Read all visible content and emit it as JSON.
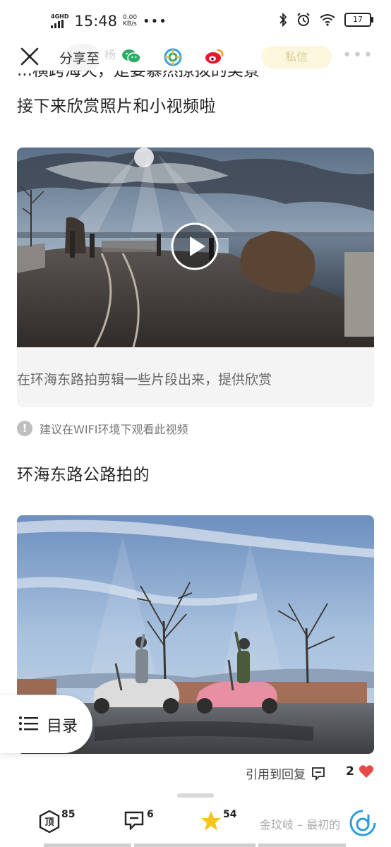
{
  "status_bar": {
    "network_label": "4GHD",
    "time": "15:48",
    "speed_value": "0.00",
    "speed_unit": "KB/s",
    "more": "•••",
    "battery": "17"
  },
  "share_bar": {
    "label": "分享至",
    "targets": [
      "wechat-icon",
      "moments-icon",
      "weibo-icon"
    ],
    "behind": {
      "author_partial": "杨",
      "action_partial": "私信",
      "more": "•••"
    }
  },
  "article": {
    "clipped_line": "...横跨海天，是要慕然撩拨的美景",
    "heading_1": "接下来欣赏照片和小视频啦",
    "video": {
      "caption": "在环海东路拍剪辑一些片段出来，提供欣赏",
      "tip": "建议在WIFI环境下观看此视频"
    },
    "heading_2": "环海东路公路拍的"
  },
  "toc": {
    "label": "目录"
  },
  "actions": {
    "quote_reply": "引用到回复",
    "like_count": "2"
  },
  "bottom_bar": {
    "top_count": "85",
    "comment_count": "6",
    "star_count": "54",
    "next_article": "金玟岐 – 最初的"
  },
  "colors": {
    "wechat": "#2aae67",
    "moments": "#36a3e0",
    "weibo": "#e6162d",
    "heart": "#e84a4a",
    "star": "#f5c518",
    "logo": "#2d9cdb"
  }
}
